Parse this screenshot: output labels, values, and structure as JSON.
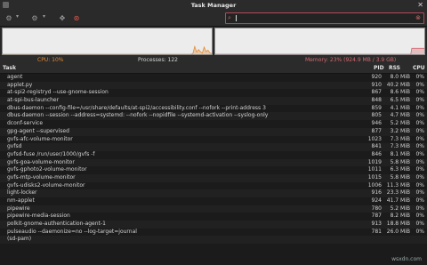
{
  "window": {
    "title": "Task Manager"
  },
  "toolbar": {
    "search_placeholder": ""
  },
  "stats": {
    "cpu": "CPU: 10%",
    "processes": "Processes: 122",
    "memory": "Memory: 23% (924.9 MB / 3.9 GB)"
  },
  "graphs": {
    "cpu_color": "#e38b33",
    "mem_color": "#d46a72",
    "cpu_history": [
      0,
      0,
      0,
      0,
      0,
      0,
      0,
      0,
      0,
      0,
      0,
      0,
      0,
      0,
      0,
      0,
      0,
      0,
      0,
      0,
      0,
      0,
      0,
      0,
      0,
      0,
      0,
      0,
      0,
      0,
      0,
      0,
      0,
      0,
      0,
      0,
      0,
      0,
      0,
      0,
      0,
      0,
      0,
      0,
      0,
      0,
      0,
      0,
      0,
      0,
      0,
      0,
      0,
      0,
      0,
      0,
      0,
      0,
      0,
      0,
      0,
      0,
      0,
      0,
      0,
      0,
      0,
      0,
      0,
      0,
      0,
      0,
      0,
      0,
      0,
      0,
      0,
      0,
      0,
      0,
      0,
      0,
      0,
      0,
      0,
      0,
      0,
      0,
      0,
      0,
      0,
      0,
      0,
      0,
      0,
      0,
      0,
      0,
      0,
      0,
      0,
      2,
      30,
      8,
      18,
      10,
      4,
      28,
      10,
      16,
      6,
      2
    ],
    "mem_history": [
      0,
      0,
      0,
      0,
      0,
      0,
      0,
      0,
      0,
      0,
      0,
      0,
      0,
      0,
      0,
      0,
      0,
      0,
      0,
      0,
      0,
      0,
      0,
      0,
      0,
      0,
      0,
      0,
      0,
      0,
      0,
      0,
      0,
      0,
      0,
      0,
      0,
      0,
      0,
      0,
      0,
      0,
      0,
      0,
      0,
      0,
      0,
      0,
      0,
      0,
      0,
      0,
      0,
      0,
      0,
      0,
      0,
      0,
      0,
      0,
      0,
      0,
      0,
      0,
      0,
      0,
      0,
      0,
      0,
      0,
      0,
      0,
      0,
      0,
      0,
      0,
      0,
      0,
      0,
      0,
      0,
      0,
      0,
      0,
      0,
      0,
      0,
      0,
      0,
      0,
      0,
      0,
      0,
      0,
      0,
      0,
      0,
      0,
      0,
      0,
      0,
      0,
      0,
      0,
      0,
      0,
      0,
      0,
      0,
      0,
      0,
      0,
      0,
      0,
      0,
      0,
      0,
      0,
      0,
      0,
      0,
      0,
      0,
      0,
      0,
      0,
      0,
      0,
      0,
      0,
      0,
      0,
      0,
      0,
      0,
      0,
      0,
      0,
      0,
      0,
      0,
      0,
      0,
      0,
      0,
      0,
      0,
      0,
      0,
      0,
      0,
      0,
      0,
      0,
      0,
      0,
      0,
      0,
      0,
      0,
      0,
      0,
      0,
      0,
      0,
      0,
      0,
      0,
      0,
      0,
      0,
      0,
      0,
      0,
      0,
      0,
      0,
      0,
      0,
      0,
      0,
      0,
      0,
      0,
      0,
      0,
      0,
      0,
      0,
      0,
      0,
      0,
      0,
      0,
      0,
      0,
      0,
      0,
      0,
      0,
      0,
      0,
      0,
      0,
      23,
      23,
      23,
      23,
      23,
      23,
      23,
      23,
      23,
      23,
      23,
      23,
      23,
      23
    ]
  },
  "table": {
    "headers": {
      "task": "Task",
      "pid": "PID",
      "rss": "RSS",
      "cpu": "CPU"
    },
    "rows": [
      {
        "task": "agent",
        "pid": "920",
        "rss": "8.0 MiB",
        "cpu": "0%"
      },
      {
        "task": "applet.py",
        "pid": "910",
        "rss": "40.2 MiB",
        "cpu": "0%"
      },
      {
        "task": "at-spi2-registryd --use-gnome-session",
        "pid": "867",
        "rss": "8.6 MiB",
        "cpu": "0%"
      },
      {
        "task": "at-spi-bus-launcher",
        "pid": "848",
        "rss": "6.5 MiB",
        "cpu": "0%"
      },
      {
        "task": "dbus-daemon --config-file=/usr/share/defaults/at-spi2/accessibility.conf --nofork --print-address 3",
        "pid": "859",
        "rss": "4.1 MiB",
        "cpu": "0%"
      },
      {
        "task": "dbus-daemon --session --address=systemd: --nofork --nopidfile --systemd-activation --syslog-only",
        "pid": "805",
        "rss": "4.7 MiB",
        "cpu": "0%"
      },
      {
        "task": "dconf-service",
        "pid": "946",
        "rss": "5.2 MiB",
        "cpu": "0%"
      },
      {
        "task": "gpg-agent --supervised",
        "pid": "877",
        "rss": "3.2 MiB",
        "cpu": "0%"
      },
      {
        "task": "gvfs-afc-volume-monitor",
        "pid": "1023",
        "rss": "7.3 MiB",
        "cpu": "0%"
      },
      {
        "task": "gvfsd",
        "pid": "841",
        "rss": "7.3 MiB",
        "cpu": "0%"
      },
      {
        "task": "gvfsd-fuse /run/user/1000/gvfs -f",
        "pid": "846",
        "rss": "8.1 MiB",
        "cpu": "0%"
      },
      {
        "task": "gvfs-goa-volume-monitor",
        "pid": "1019",
        "rss": "5.8 MiB",
        "cpu": "0%"
      },
      {
        "task": "gvfs-gphoto2-volume-monitor",
        "pid": "1011",
        "rss": "6.3 MiB",
        "cpu": "0%"
      },
      {
        "task": "gvfs-mtp-volume-monitor",
        "pid": "1015",
        "rss": "5.8 MiB",
        "cpu": "0%"
      },
      {
        "task": "gvfs-udisks2-volume-monitor",
        "pid": "1006",
        "rss": "11.3 MiB",
        "cpu": "0%"
      },
      {
        "task": "light-locker",
        "pid": "916",
        "rss": "23.3 MiB",
        "cpu": "0%"
      },
      {
        "task": "nm-applet",
        "pid": "924",
        "rss": "41.7 MiB",
        "cpu": "0%"
      },
      {
        "task": "pipewire",
        "pid": "780",
        "rss": "5.2 MiB",
        "cpu": "0%"
      },
      {
        "task": "pipewire-media-session",
        "pid": "787",
        "rss": "8.2 MiB",
        "cpu": "0%"
      },
      {
        "task": "polkit-gnome-authentication-agent-1",
        "pid": "913",
        "rss": "18.8 MiB",
        "cpu": "0%"
      },
      {
        "task": "pulseaudio --daemonize=no --log-target=journal",
        "pid": "781",
        "rss": "26.0 MiB",
        "cpu": "0%"
      },
      {
        "task": "(sd-pam)",
        "pid": "",
        "rss": "",
        "cpu": ""
      }
    ]
  },
  "watermark": "wsxdn.com"
}
